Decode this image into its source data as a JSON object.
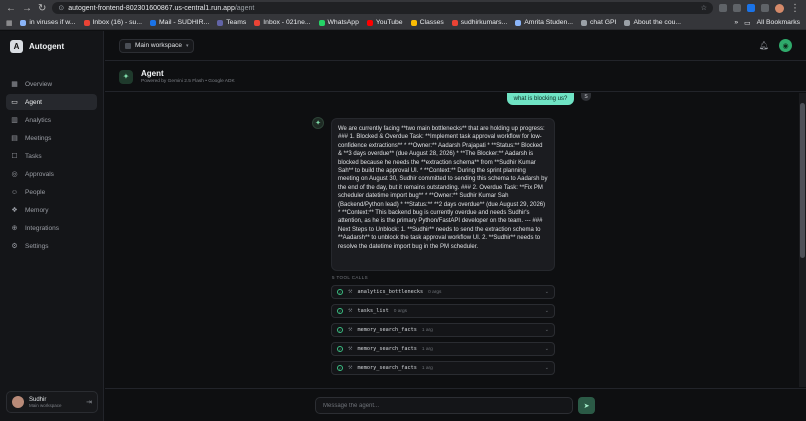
{
  "browser": {
    "url_host": "autogent-frontend-802301600867.us-central1.run.app",
    "url_path": "/agent",
    "bookmarks": [
      {
        "label": "in viruses if w...",
        "color": "#8ab4f8"
      },
      {
        "label": "Inbox (16) - su...",
        "color": "#ea4335"
      },
      {
        "label": "Mail - SUDHIR...",
        "color": "#1a73e8"
      },
      {
        "label": "Teams",
        "color": "#6264a7"
      },
      {
        "label": "Inbox - 021ne...",
        "color": "#ea4335"
      },
      {
        "label": "WhatsApp",
        "color": "#25d366"
      },
      {
        "label": "YouTube",
        "color": "#ff0000"
      },
      {
        "label": "Classes",
        "color": "#fbbc04"
      },
      {
        "label": "sudhirkumars...",
        "color": "#ea4335"
      },
      {
        "label": "Amrita Studen...",
        "color": "#8ab4f8"
      },
      {
        "label": "chat GPI",
        "color": "#9aa0a6"
      },
      {
        "label": "About the cou...",
        "color": "#9aa0a6"
      }
    ],
    "all_bookmarks": "All Bookmarks"
  },
  "brand": {
    "logo": "A",
    "name": "Autogent"
  },
  "sidebar": {
    "items": [
      {
        "label": "Overview",
        "icon": "grid-icon"
      },
      {
        "label": "Agent",
        "icon": "chat-icon"
      },
      {
        "label": "Analytics",
        "icon": "bar-chart-icon"
      },
      {
        "label": "Meetings",
        "icon": "calendar-icon"
      },
      {
        "label": "Tasks",
        "icon": "checkbox-icon"
      },
      {
        "label": "Approvals",
        "icon": "check-circle-icon"
      },
      {
        "label": "People",
        "icon": "people-icon"
      },
      {
        "label": "Memory",
        "icon": "brain-icon"
      },
      {
        "label": "Integrations",
        "icon": "link-icon"
      },
      {
        "label": "Settings",
        "icon": "gear-icon"
      }
    ],
    "user": {
      "name": "Sudhir",
      "workspace": "Main workspace"
    }
  },
  "topbar": {
    "workspace": "Main workspace"
  },
  "agent": {
    "title": "Agent",
    "subtitle": "Powered by Gemini 2.5 Flash • Google ADK"
  },
  "chat": {
    "user_message": "what is blocking us?",
    "user_initial": "S",
    "bot_message": "We are currently facing **two main bottlenecks** that are holding up progress: ### 1. Blocked & Overdue Task: **Implement task approval workflow for low-confidence extractions** * **Owner:** Aadarsh Prajapati * **Status:** Blocked & **3 days overdue** (due August 28, 2026) * **The Blocker:** Aadarsh is blocked because he needs the **extraction schema** from **Sudhir Kumar Sah** to build the approval UI. * **Context:** During the sprint planning meeting on August 30, Sudhir committed to sending this schema to Aadarsh by the end of the day, but it remains outstanding. ### 2. Overdue Task: **Fix PM scheduler datetime import bug** * **Owner:** Sudhir Kumar Sah (Backend/Python lead) * **Status:** **2 days overdue** (due August 29, 2026) * **Context:** This backend bug is currently overdue and needs Sudhir's attention, as he is the primary Python/FastAPI developer on the team. --- ### Next Steps to Unblock: 1. **Sudhir** needs to send the extraction schema to **Aadarsh** to unblock the task approval workflow UI. 2. **Sudhir** needs to resolve the datetime import bug in the PM scheduler.",
    "tools_label": "5 TOOL CALLS",
    "tools": [
      {
        "name": "analytics_bottlenecks",
        "args": "0 args"
      },
      {
        "name": "tasks_list",
        "args": "0 args"
      },
      {
        "name": "memory_search_facts",
        "args": "1 arg"
      },
      {
        "name": "memory_search_facts",
        "args": "1 arg"
      },
      {
        "name": "memory_search_facts",
        "args": "1 arg"
      }
    ]
  },
  "input": {
    "placeholder": "Message the agent..."
  }
}
